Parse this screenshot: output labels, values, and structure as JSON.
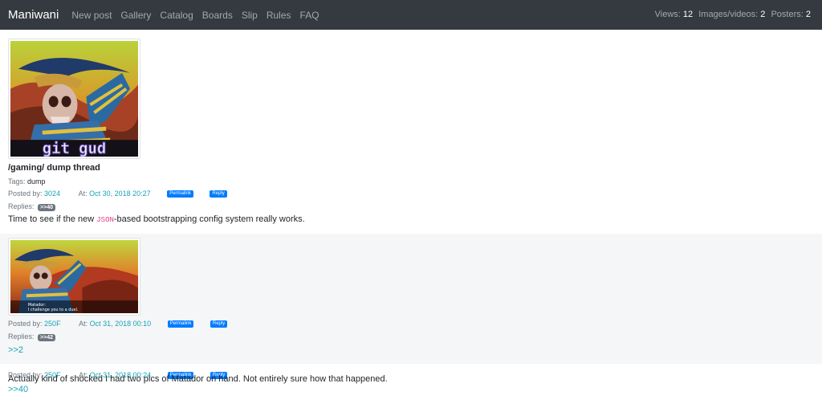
{
  "navbar": {
    "brand": "Maniwani",
    "links": [
      "New post",
      "Gallery",
      "Catalog",
      "Boards",
      "Slip",
      "Rules",
      "FAQ"
    ],
    "stats": {
      "views_label": "Views:",
      "views": "12",
      "images_label": "Images/videos:",
      "images": "2",
      "posters_label": "Posters:",
      "posters": "2"
    }
  },
  "thread": {
    "subject": "/gaming/ dump thread",
    "tags_label": "Tags:",
    "tag": "dump",
    "op": {
      "image_caption": "git gud",
      "posted_by_label": "Posted by:",
      "author": "3024",
      "at_label": "At:",
      "date": "Oct 30, 2018 20:27",
      "permalink": "Permalink",
      "reply": "Reply",
      "replies_label": "Replies:",
      "reply_ref": ">>40",
      "body_before": "Time to see if the new ",
      "body_code": "JSON",
      "body_after": "-based bootstrapping config system really works."
    },
    "reply1": {
      "subtitle_line1": "Matador:",
      "subtitle_line2": "I challenge you to a duel.",
      "posted_by_label": "Posted by:",
      "author": "250F",
      "at_label": "At:",
      "date": "Oct 31, 2018 00:10",
      "permalink": "Permalink",
      "reply": "Reply",
      "replies_label": "Replies:",
      "reply_ref": ">>42",
      "quote": ">>2"
    },
    "reply2": {
      "posted_by_label": "Posted by:",
      "author": "250F",
      "at_label": "At:",
      "date": "Oct 31, 2018 00:24",
      "permalink": "Permalink",
      "reply": "Reply",
      "quote": ">>40",
      "body": "Actually kind of shocked I had two pics of Matador on hand. Not entirely sure how that happened."
    }
  },
  "colors": {
    "navbar_bg": "#343a40",
    "link": "#17a2b8",
    "button": "#007bff",
    "badge": "#6c757d",
    "code": "#e83e8c"
  }
}
